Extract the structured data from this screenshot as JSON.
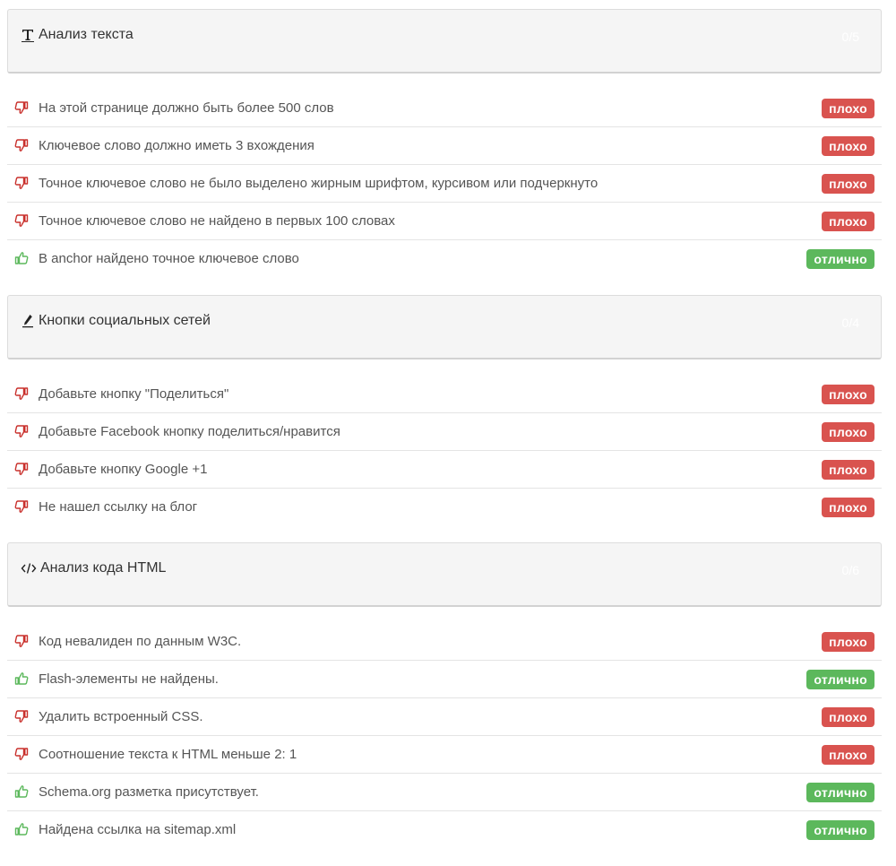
{
  "colors": {
    "bad": "#d9534f",
    "good": "#5cb85c",
    "bad_icon": "#c9302c",
    "good_icon": "#5cb85c"
  },
  "sections": [
    {
      "title": "Анализ текста",
      "icon": "text-format-icon",
      "score": "0/5",
      "items": [
        {
          "text": "На этой странице должно быть более 500 слов",
          "status": "плохо",
          "icon": "thumbs-down-icon"
        },
        {
          "text": "Ключевое слово должно иметь 3 вхождения",
          "status": "плохо",
          "icon": "thumbs-down-icon"
        },
        {
          "text": "Точное ключевое слово не было выделено жирным шрифтом, курсивом или подчеркнуто",
          "status": "плохо",
          "icon": "thumbs-down-icon"
        },
        {
          "text": "Точное ключевое слово не найдено в первых 100 словах",
          "status": "плохо",
          "icon": "thumbs-down-icon"
        },
        {
          "text": "В anchor найдено точное ключевое слово",
          "status": "отлично",
          "icon": "thumbs-up-icon"
        }
      ]
    },
    {
      "title": "Кнопки социальных сетей",
      "icon": "pen-icon",
      "score": "0/4",
      "items": [
        {
          "text": "Добавьте кнопку \"Поделиться\"",
          "status": "плохо",
          "icon": "thumbs-down-icon"
        },
        {
          "text": "Добавьте Facebook кнопку поделиться/нравится",
          "status": "плохо",
          "icon": "thumbs-down-icon"
        },
        {
          "text": "Добавьте кнопку Google +1",
          "status": "плохо",
          "icon": "thumbs-down-icon"
        },
        {
          "text": "Не нашел ссылку на блог",
          "status": "плохо",
          "icon": "thumbs-down-icon"
        }
      ]
    },
    {
      "title": "Анализ кода HTML",
      "icon": "code-icon",
      "score": "0/6",
      "items": [
        {
          "text": "Код невалиден по данным W3C.",
          "status": "плохо",
          "icon": "thumbs-down-icon"
        },
        {
          "text": "Flash-элементы не найдены.",
          "status": "отлично",
          "icon": "thumbs-up-icon"
        },
        {
          "text": "Удалить встроенный CSS.",
          "status": "плохо",
          "icon": "thumbs-down-icon"
        },
        {
          "text": "Соотношение текста к HTML меньше 2: 1",
          "status": "плохо",
          "icon": "thumbs-down-icon"
        },
        {
          "text": "Schema.org разметка присутствует.",
          "status": "отлично",
          "icon": "thumbs-up-icon"
        },
        {
          "text": "Найдена ссылка на sitemap.xml",
          "status": "отлично",
          "icon": "thumbs-up-icon"
        }
      ]
    }
  ]
}
